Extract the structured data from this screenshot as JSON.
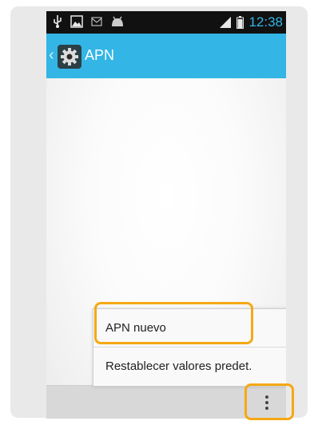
{
  "status_bar": {
    "time": "12:38",
    "left_icons": [
      "usb-icon",
      "image-icon",
      "mail-icon",
      "android-icon"
    ],
    "right_icons": [
      "signal-icon",
      "battery-icon"
    ]
  },
  "action_bar": {
    "title": "APN",
    "app_icon": "settings-gear-icon"
  },
  "overflow_menu": {
    "items": [
      {
        "label": "APN nuevo"
      },
      {
        "label": "Restablecer valores predet."
      }
    ]
  },
  "nav_bar": {
    "overflow_icon": "more-vert-icon"
  },
  "annotations": {
    "highlight_color": "#f5a814"
  },
  "colors": {
    "accent": "#33b5e5",
    "status_bar_bg": "#111111"
  }
}
